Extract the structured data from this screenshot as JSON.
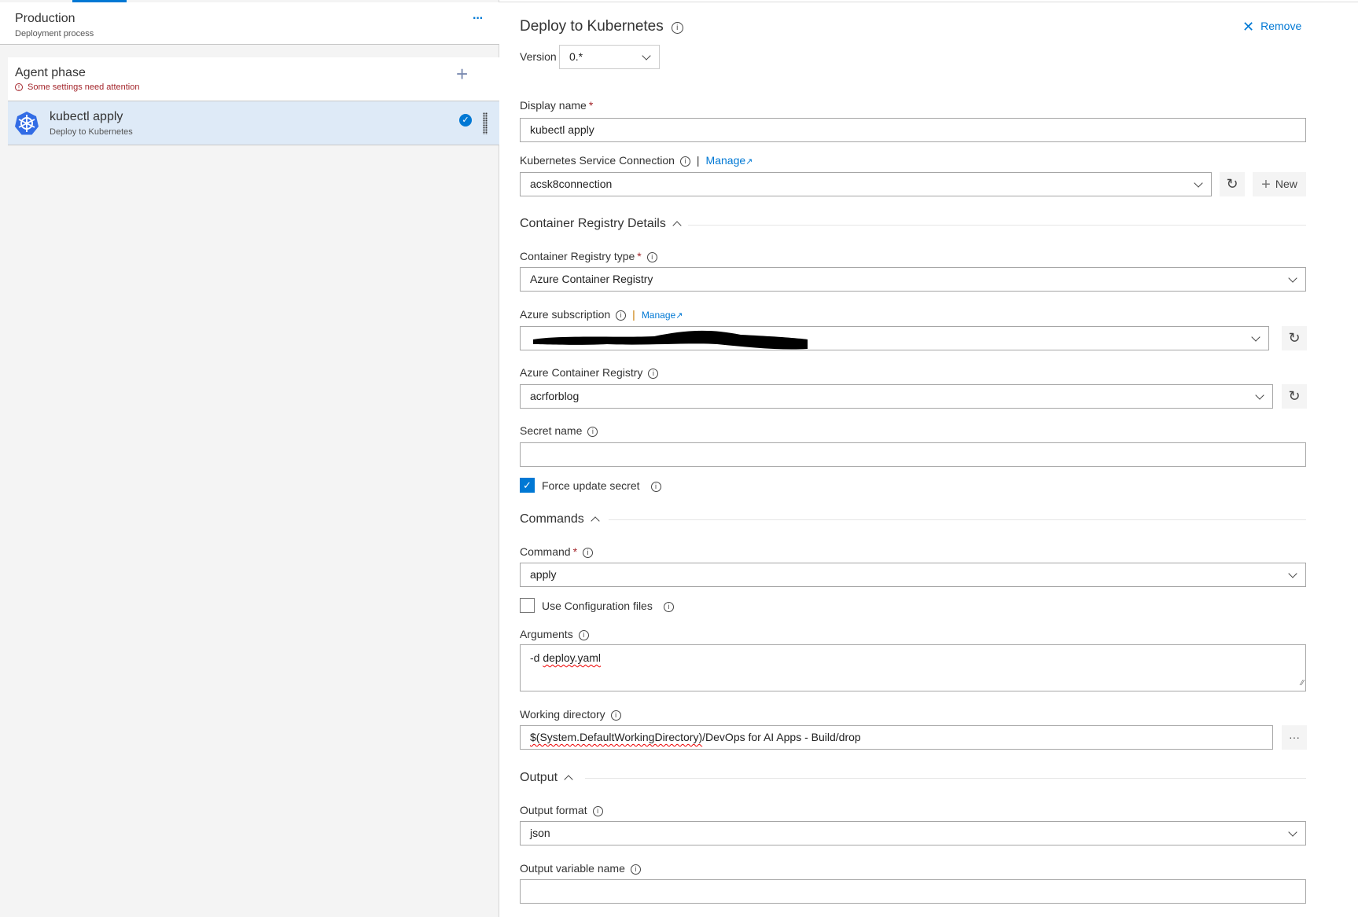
{
  "left_panel": {
    "stage": {
      "title": "Production",
      "subtitle": "Deployment process",
      "more_label": "···"
    },
    "phase": {
      "title": "Agent phase",
      "warning": "Some settings need attention",
      "add_label": "+"
    },
    "task": {
      "title": "kubectl apply",
      "subtitle": "Deploy to Kubernetes",
      "enabled": true
    }
  },
  "task_editor": {
    "title": "Deploy to Kubernetes",
    "remove_label": "Remove",
    "version_label": "Version",
    "version_value": "0.*",
    "display_name": {
      "label": "Display name",
      "value": "kubectl apply"
    },
    "k8s_connection": {
      "label": "Kubernetes Service Connection",
      "manage_label": "Manage",
      "value": "acsk8connection",
      "new_label": "New"
    },
    "registry_section": "Container Registry Details",
    "registry_type": {
      "label": "Container Registry type",
      "value": "Azure Container Registry"
    },
    "azure_subscription": {
      "label": "Azure subscription",
      "manage_label": "Manage",
      "value_redacted": true
    },
    "acr": {
      "label": "Azure Container Registry",
      "value": "acrforblog"
    },
    "secret_name": {
      "label": "Secret name",
      "value": ""
    },
    "force_update": {
      "label": "Force update secret",
      "checked": true
    },
    "commands_section": "Commands",
    "command": {
      "label": "Command",
      "value": "apply"
    },
    "use_config": {
      "label": "Use Configuration files",
      "checked": false
    },
    "arguments": {
      "label": "Arguments",
      "prefix": "-d ",
      "file": "deploy.yaml"
    },
    "working_dir": {
      "label": "Working directory",
      "var": "$(System.DefaultWorkingDirectory)",
      "rest": "/DevOps for AI Apps - Build/drop",
      "browse_label": "···"
    },
    "output_section": "Output",
    "output_format": {
      "label": "Output format",
      "value": "json"
    },
    "output_variable": {
      "label": "Output variable name",
      "value": ""
    }
  },
  "colors": {
    "accent": "#0078d4",
    "selected_row": "#deeaf7",
    "warning": "#a4262c"
  }
}
